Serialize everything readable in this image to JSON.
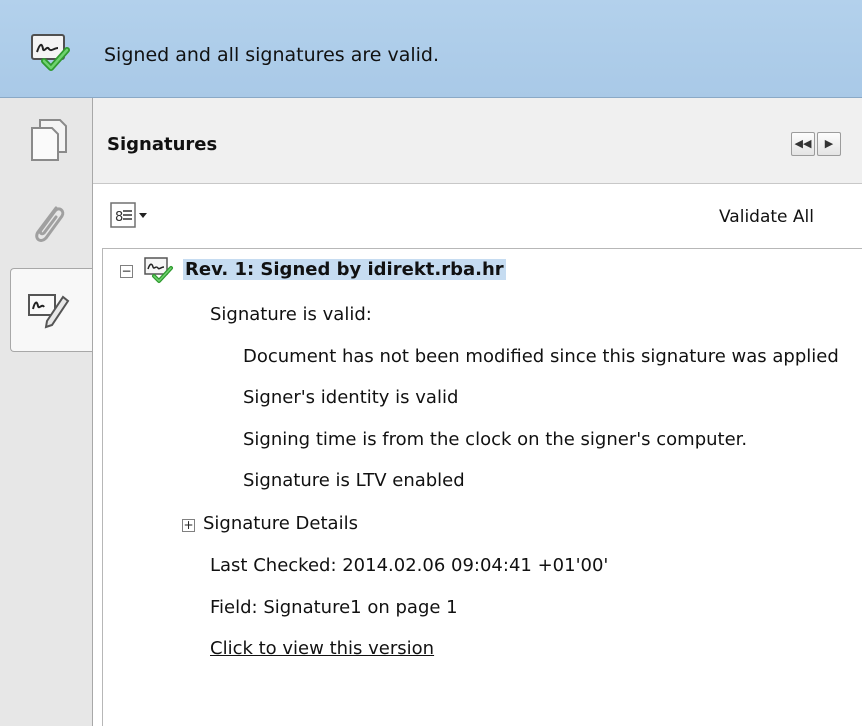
{
  "banner": {
    "message": "Signed and all signatures are valid.",
    "icon": "signature-valid-icon"
  },
  "leftnav": {
    "items": [
      {
        "name": "pages",
        "icon": "pages-icon",
        "active": false
      },
      {
        "name": "attachments",
        "icon": "paperclip-icon",
        "active": false
      },
      {
        "name": "signatures",
        "icon": "signature-pen-icon",
        "active": true
      }
    ]
  },
  "panel": {
    "title": "Signatures",
    "collapse_left_glyph": "◀◀",
    "collapse_right_glyph": "▶",
    "options_icon": "list-options-icon",
    "validate_all_label": "Validate All"
  },
  "tree": {
    "revision_expander": "−",
    "revision_label": "Rev. 1: Signed by idirekt.rba.hr",
    "status_heading": "Signature is valid:",
    "status_items": [
      "Document has not been modified since this signature was applied",
      "Signer's identity is valid",
      "Signing time is from the clock on the signer's computer.",
      "Signature is LTV enabled"
    ],
    "details_expander": "+",
    "details_label": "Signature Details",
    "last_checked": "Last Checked: 2014.02.06 09:04:41 +01'00'",
    "field": "Field: Signature1 on page 1",
    "view_version_link": "Click to view this version"
  },
  "colors": {
    "banner_bg": "#b3d1ec",
    "selection_bg": "#c6dcf1",
    "check_green": "#3aa63a"
  }
}
